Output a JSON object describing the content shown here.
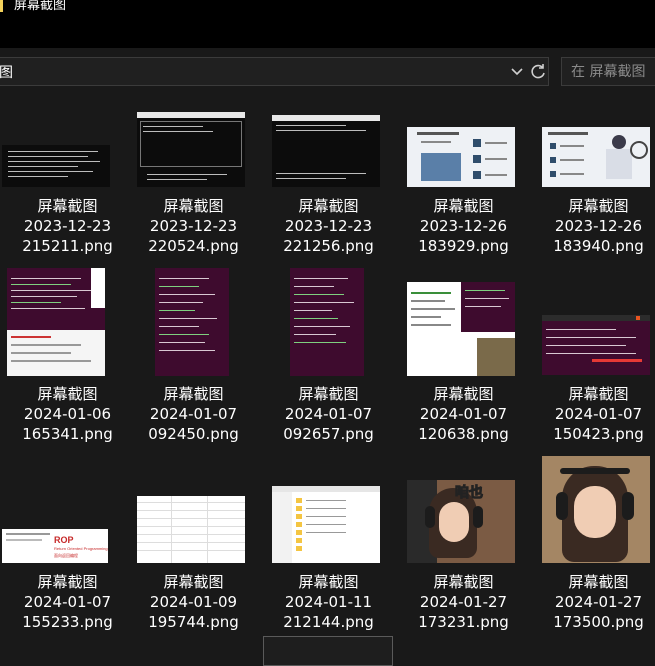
{
  "window": {
    "title": "屏幕截图"
  },
  "address_bar": {
    "current_folder": "图"
  },
  "search": {
    "placeholder": "在 屏幕截图"
  },
  "files": [
    {
      "name_line1": "屏幕截图",
      "name_line2": "2023-12-23",
      "name_line3": "215211.png"
    },
    {
      "name_line1": "屏幕截图",
      "name_line2": "2023-12-23",
      "name_line3": "220524.png"
    },
    {
      "name_line1": "屏幕截图",
      "name_line2": "2023-12-23",
      "name_line3": "221256.png"
    },
    {
      "name_line1": "屏幕截图",
      "name_line2": "2023-12-26",
      "name_line3": "183929.png"
    },
    {
      "name_line1": "屏幕截图",
      "name_line2": "2023-12-26",
      "name_line3": "183940.png"
    },
    {
      "name_line1": "屏幕截图",
      "name_line2": "2024-01-06",
      "name_line3": "165341.png"
    },
    {
      "name_line1": "屏幕截图",
      "name_line2": "2024-01-07",
      "name_line3": "092450.png"
    },
    {
      "name_line1": "屏幕截图",
      "name_line2": "2024-01-07",
      "name_line3": "092657.png"
    },
    {
      "name_line1": "屏幕截图",
      "name_line2": "2024-01-07",
      "name_line3": "120638.png"
    },
    {
      "name_line1": "屏幕截图",
      "name_line2": "2024-01-07",
      "name_line3": "150423.png"
    },
    {
      "name_line1": "屏幕截图",
      "name_line2": "2024-01-07",
      "name_line3": "155233.png"
    },
    {
      "name_line1": "屏幕截图",
      "name_line2": "2024-01-09",
      "name_line3": "195744.png"
    },
    {
      "name_line1": "屏幕截图",
      "name_line2": "2024-01-11",
      "name_line3": "212144.png"
    },
    {
      "name_line1": "屏幕截图",
      "name_line2": "2024-01-27",
      "name_line3": "173231.png"
    },
    {
      "name_line1": "屏幕截图",
      "name_line2": "2024-01-27",
      "name_line3": "173500.png"
    }
  ],
  "thumbnail_text": {
    "rop_title": "ROP",
    "rop_subtitle": "Return Oriented Programming",
    "rop_cn": "面向返回编程",
    "photo_overlay": "咱也"
  },
  "colors": {
    "background": "#191919",
    "titlebar": "#000000",
    "accent": "#f3d15b",
    "ubuntu_terminal": "#3e0b2e"
  }
}
